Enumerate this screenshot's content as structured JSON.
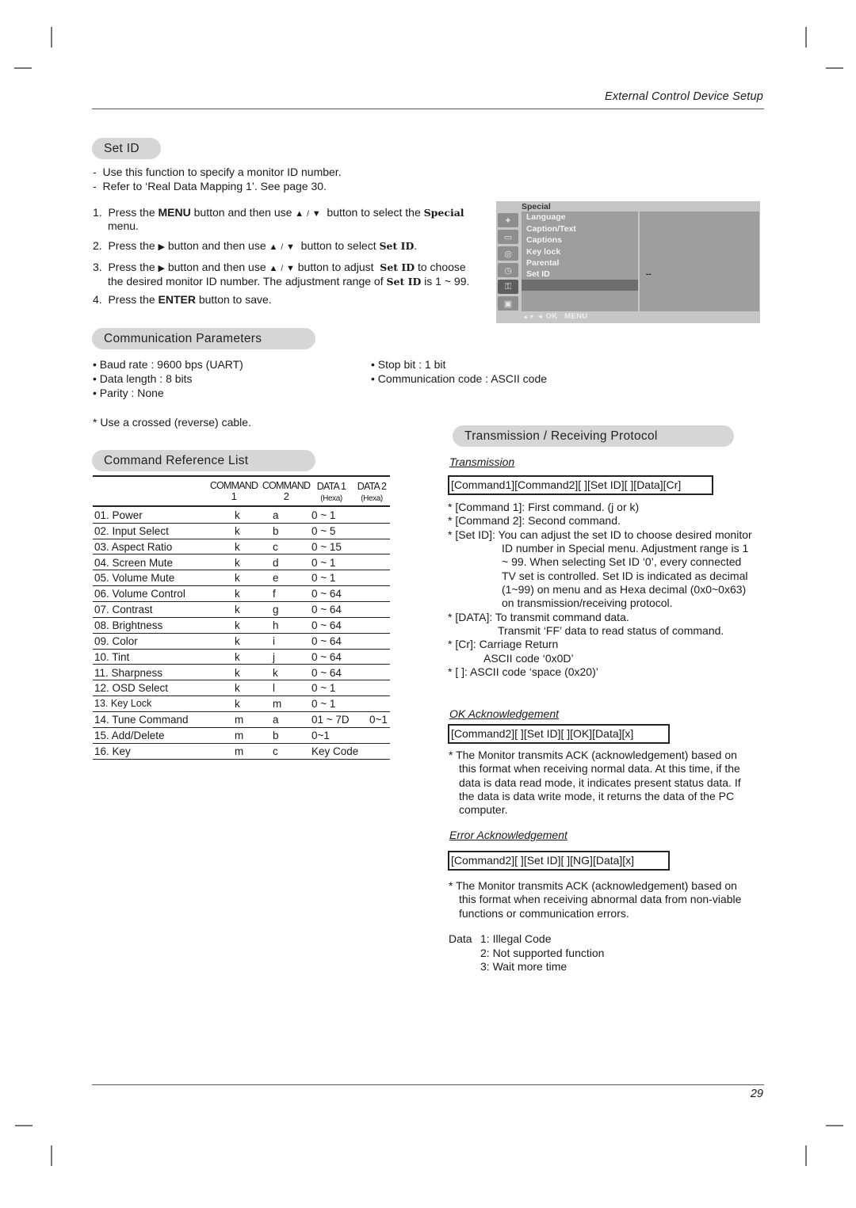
{
  "header": {
    "running_title": "External Control Device Setup"
  },
  "set_id": {
    "title": "Set ID",
    "notes": [
      "Use this function to specify a monitor ID number.",
      "Refer to ‘Real Data Mapping 1’. See page 30."
    ],
    "steps": {
      "s1": {
        "num": "1.",
        "a": "Press the ",
        "b": "MENU",
        "c": " button and then use ",
        "d": " button to select the ",
        "e": "Special",
        "f": "menu."
      },
      "s2": {
        "num": "2.",
        "a": "Press the ",
        "c": " button and then use ",
        "d": " button to select ",
        "e": "Set ID",
        "f": "."
      },
      "s3": {
        "num": "3.",
        "a": "Press the ",
        "c": " button and then use ",
        "d": " button to adjust ",
        "e": "Set ID",
        "f": " to choose",
        "g": "the desired monitor ID number. The adjustment range of ",
        "h": "Set ID",
        "i": " is 1 ~ 99."
      },
      "s4": {
        "num": "4.",
        "a": "Press the ",
        "b": "ENTER",
        "c": " button to save."
      }
    },
    "glyphs": {
      "up": "▲",
      "down": "▼",
      "right": "▶",
      "sep": "/"
    }
  },
  "osd_menu": {
    "title": "Special",
    "items": [
      "Language",
      "Caption/Text",
      "Captions",
      "Key lock",
      "Parental",
      "Set ID"
    ],
    "selected": "Set ID",
    "value": "--",
    "footer": {
      "nav": "▲▼",
      "back": "◄",
      "ok": "OK",
      "menu": "MENU"
    },
    "icons": [
      "satellite-icon",
      "picture-icon",
      "speaker-icon",
      "clock-icon",
      "special-key-icon",
      "pc-screen-icon"
    ]
  },
  "comm_params": {
    "title": "Communication Parameters",
    "left": [
      "• Baud rate : 9600 bps (UART)",
      "• Data length : 8 bits",
      "• Parity : None"
    ],
    "right": [
      "• Stop bit : 1 bit",
      "• Communication code : ASCII code"
    ],
    "note": "* Use a crossed (reverse) cable."
  },
  "command_ref": {
    "title": "Command Reference List",
    "headers": {
      "cmd1": "COMMAND",
      "cmd1_sub": "1",
      "cmd2": "COMMAND",
      "cmd2_sub": "2",
      "data1": "DATA 1",
      "data1_sub": "(Hexa)",
      "data2": "DATA 2",
      "data2_sub": "(Hexa)"
    },
    "rows": [
      {
        "name": "01. Power",
        "c1": "k",
        "c2": "a",
        "d1": "0 ~ 1",
        "d2": ""
      },
      {
        "name": "02. Input Select",
        "c1": "k",
        "c2": "b",
        "d1": "0 ~ 5",
        "d2": ""
      },
      {
        "name": "03. Aspect Ratio",
        "c1": "k",
        "c2": "c",
        "d1": "0 ~ 15",
        "d2": ""
      },
      {
        "name": "04. Screen Mute",
        "c1": "k",
        "c2": "d",
        "d1": "0 ~ 1",
        "d2": ""
      },
      {
        "name": "05. Volume Mute",
        "c1": "k",
        "c2": "e",
        "d1": "0 ~ 1",
        "d2": ""
      },
      {
        "name": "06. Volume Control",
        "c1": "k",
        "c2": "f",
        "d1": "0 ~ 64",
        "d2": ""
      },
      {
        "name": "07. Contrast",
        "c1": "k",
        "c2": "g",
        "d1": "0 ~ 64",
        "d2": ""
      },
      {
        "name": "08. Brightness",
        "c1": "k",
        "c2": "h",
        "d1": "0 ~ 64",
        "d2": ""
      },
      {
        "name": "09. Color",
        "c1": "k",
        "c2": "i",
        "d1": "0 ~ 64",
        "d2": ""
      },
      {
        "name": "10. Tint",
        "c1": "k",
        "c2": "j",
        "d1": "0 ~ 64",
        "d2": ""
      },
      {
        "name": "11. Sharpness",
        "c1": "k",
        "c2": "k",
        "d1": "0 ~ 64",
        "d2": ""
      },
      {
        "name": "12. OSD Select",
        "c1": "k",
        "c2": "l",
        "d1": "0 ~ 1",
        "d2": ""
      },
      {
        "name": "13. Key Lock",
        "c1": "k",
        "c2": "m",
        "d1": "0 ~ 1",
        "d2": ""
      },
      {
        "name": "14. Tune Command",
        "c1": "m",
        "c2": "a",
        "d1": "01 ~ 7D",
        "d2": "0~1"
      },
      {
        "name": "15. Add/Delete",
        "c1": "m",
        "c2": "b",
        "d1": "0~1",
        "d2": ""
      },
      {
        "name": "16. Key",
        "c1": "m",
        "c2": "c",
        "d1": "Key Code",
        "d2": ""
      }
    ]
  },
  "protocol": {
    "title": "Transmission / Receiving  Protocol",
    "transmission": {
      "heading": "Transmission",
      "format": "[Command1][Command2][  ][Set ID][  ][Data][Cr]",
      "notes": [
        "* [Command 1]: First command. (j or k)",
        "* [Command 2]: Second command.",
        "* [Set ID]: You can adjust the set ID to choose desired monitor",
        "ID number in Special menu. Adjustment range is 1",
        "~ 99. When selecting Set ID ‘0’, every connected",
        "TV set is controlled. Set ID is indicated as decimal",
        "(1~99) on menu and as Hexa decimal (0x0~0x63)",
        "on transmission/receiving protocol.",
        "* [DATA]: To transmit command data.",
        "Transmit ‘FF’ data to read status of command.",
        "* [Cr]: Carriage Return",
        "ASCII code ‘0x0D’",
        "* [   ]: ASCII code ‘space (0x20)’"
      ]
    },
    "ok_ack": {
      "heading": "OK Acknowledgement",
      "format": "[Command2][  ][Set ID][  ][OK][Data][x]",
      "notes": [
        "* The Monitor transmits ACK (acknowledgement) based on",
        "this format when receiving normal data. At this time, if the",
        "data is data read mode, it indicates present status data. If",
        "the data is data write mode, it returns the data of the PC",
        "computer."
      ]
    },
    "error_ack": {
      "heading": "Error Acknowledgement",
      "format": "[Command2][  ][Set ID][  ][NG][Data][x]",
      "notes": [
        "* The Monitor transmits ACK (acknowledgement) based on",
        "this format when receiving abnormal data from non-viable",
        "functions or communication errors."
      ],
      "data_label": "Data",
      "codes": [
        "1: Illegal Code",
        "2: Not supported function",
        "3: Wait more time"
      ]
    }
  },
  "footer": {
    "page_number": "29"
  }
}
